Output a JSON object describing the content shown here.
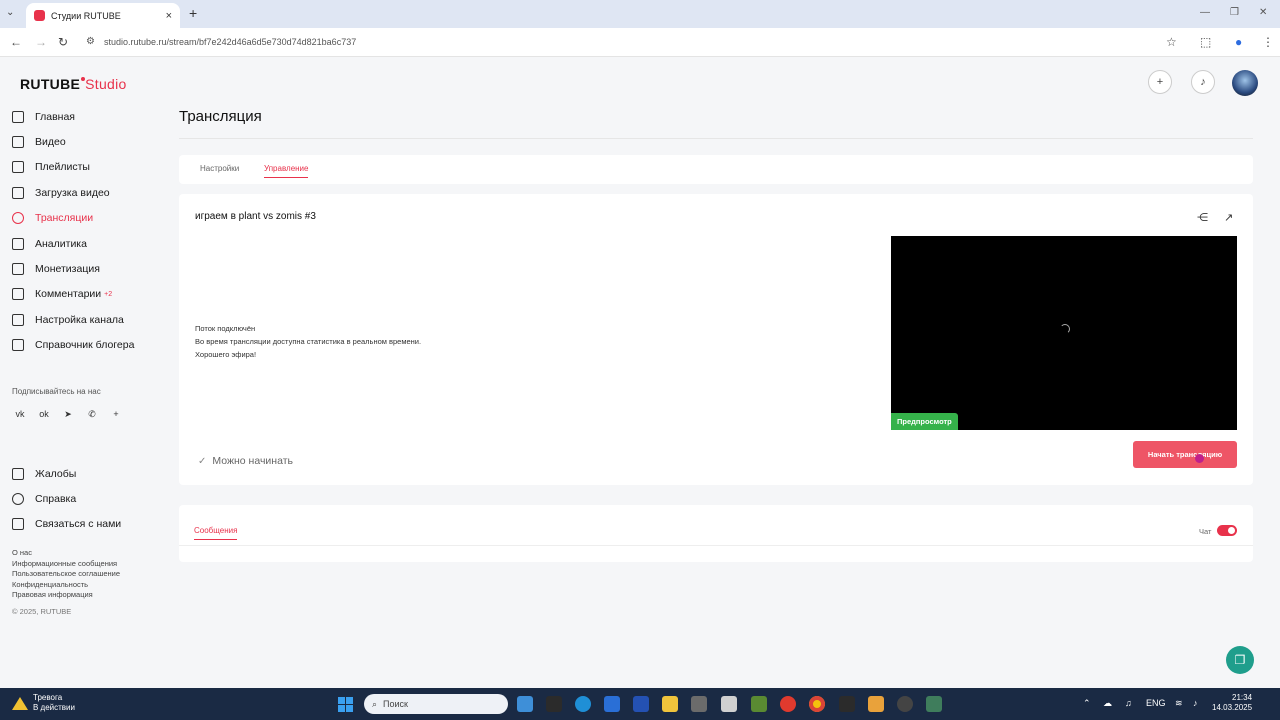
{
  "browser": {
    "tab_title": "Студии RUTUBE",
    "url": "studio.rutube.ru/stream/bf7e242d46a6d5e730d74d821ba6c737"
  },
  "app": {
    "logo_main": "RUTUBE",
    "logo_sub": "Studio",
    "page_title": "Трансляция"
  },
  "nav": {
    "items": [
      {
        "label": "Главная",
        "icon": "home-icon"
      },
      {
        "label": "Видео",
        "icon": "video-icon"
      },
      {
        "label": "Плейлисты",
        "icon": "playlist-icon"
      },
      {
        "label": "Загрузка видео",
        "icon": "upload-icon"
      },
      {
        "label": "Трансляции",
        "icon": "broadcast-icon"
      },
      {
        "label": "Аналитика",
        "icon": "analytics-icon"
      },
      {
        "label": "Монетизация",
        "icon": "monetization-icon"
      },
      {
        "label": "Комментарии",
        "icon": "comments-icon",
        "badge": "+2"
      },
      {
        "label": "Настройка канала",
        "icon": "channel-settings-icon"
      },
      {
        "label": "Справочник блогера",
        "icon": "handbook-icon"
      }
    ],
    "subscribe_label": "Подписывайтесь на нас",
    "bottom": [
      {
        "label": "Жалобы",
        "icon": "flag-icon"
      },
      {
        "label": "Справка",
        "icon": "help-icon"
      },
      {
        "label": "Связаться с нами",
        "icon": "mail-icon"
      }
    ],
    "footer_links": [
      "О нас",
      "Информационные сообщения",
      "Пользовательское соглашение",
      "Конфиденциальность",
      "Правовая информация"
    ],
    "copyright": "© 2025, RUTUBE"
  },
  "tabs": {
    "settings": "Настройки",
    "manage": "Управление"
  },
  "stream": {
    "title": "играем в plant vs zomis #3",
    "status_title": "Поток подключён",
    "status_line1": "Во время трансляции доступна статистика в реальном времени.",
    "status_line2": "Хорошего эфира!",
    "preview_badge": "Предпросмотр",
    "ready_text": "Можно начинать",
    "start_button": "Начать трансляцию"
  },
  "messages": {
    "tab": "Сообщения",
    "chat_label": "Чат"
  },
  "taskbar": {
    "alert_title": "Тревога",
    "alert_sub": "В действии",
    "search_placeholder": "Поиск",
    "lang": "ENG",
    "time": "21:34",
    "date": "14.03.2025"
  },
  "colors": {
    "accent": "#e8324b",
    "preview_badge": "#35b24a",
    "start_button": "#ee5566"
  }
}
